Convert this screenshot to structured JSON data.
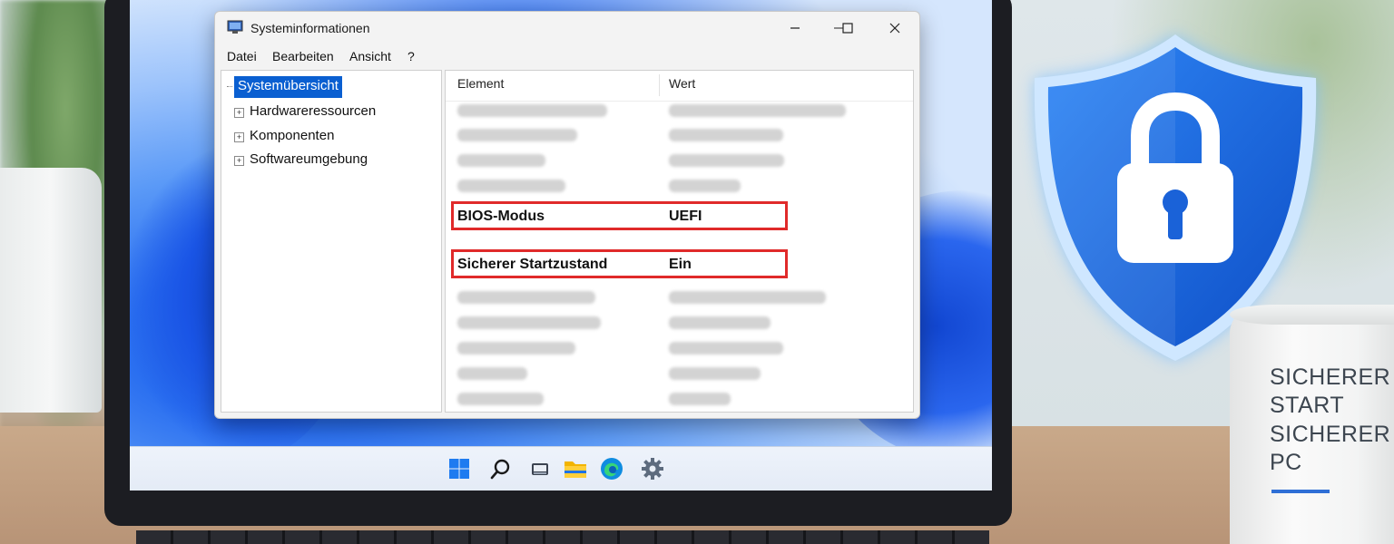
{
  "window": {
    "title": "Systeminformationen",
    "menu": [
      "Datei",
      "Bearbeiten",
      "Ansicht",
      "?"
    ]
  },
  "tree": {
    "selected": "Systemübersicht",
    "items": [
      "Hardwareressourcen",
      "Komponenten",
      "Softwareumgebung"
    ]
  },
  "list": {
    "headers": {
      "element": "Element",
      "value": "Wert"
    },
    "highlighted_rows": [
      {
        "element": "BIOS-Modus",
        "value": "UEFI"
      },
      {
        "element": "Sicherer Startzustand",
        "value": "Ein"
      }
    ]
  },
  "mug": {
    "lines": [
      "SICHERER",
      "START",
      "SICHERER",
      "PC"
    ]
  },
  "colors": {
    "highlight_border": "#e02a2a",
    "selection": "#0a5fd1",
    "shield_blue": "#1f6fe8"
  },
  "taskbar_icons": [
    "windows-start-icon",
    "search-icon",
    "task-view-icon",
    "file-explorer-icon",
    "edge-browser-icon",
    "settings-gear-icon"
  ]
}
